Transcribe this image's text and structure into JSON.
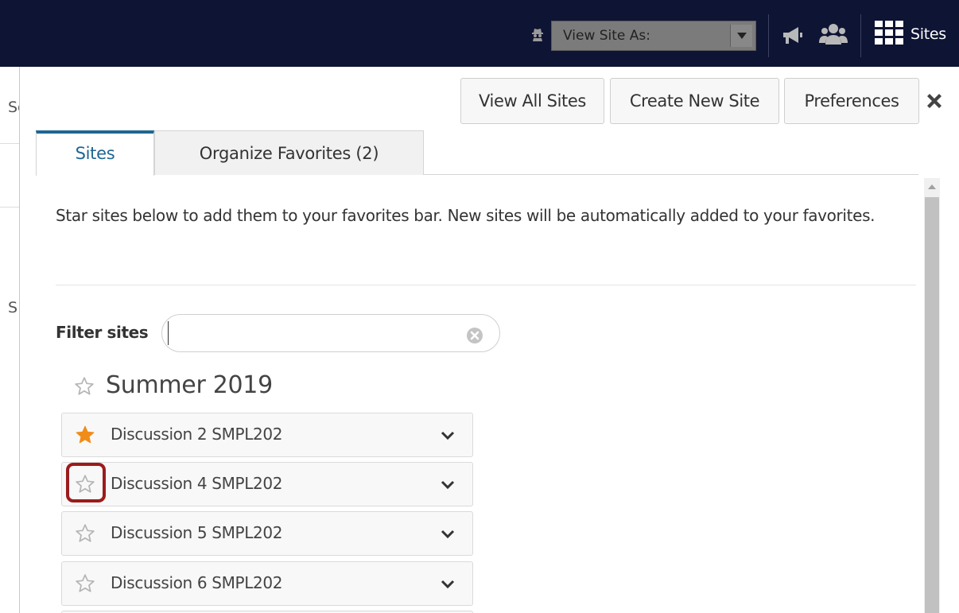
{
  "topbar": {
    "view_site_as_label": "View Site As:",
    "sites_label": "Sites",
    "icons": [
      "user-secret-icon",
      "caret-down-icon",
      "megaphone-icon",
      "people-icon",
      "grid-icon"
    ]
  },
  "background_page": {
    "stub_top": "Sc",
    "stub_mid": "S"
  },
  "panel": {
    "buttons": {
      "view_all": "View All Sites",
      "create_new": "Create New Site",
      "preferences": "Preferences"
    },
    "tabs": [
      {
        "label": "Sites",
        "active": true
      },
      {
        "label": "Organize Favorites (2)",
        "active": false
      }
    ],
    "intro_text": "Star sites below to add them to your favorites bar. New sites will be automatically added to your favorites.",
    "filter": {
      "label": "Filter sites",
      "value": "",
      "placeholder": ""
    },
    "term": {
      "heading": "Summer 2019",
      "favorite": false
    },
    "sites": [
      {
        "name": "Discussion 2 SMPL202",
        "favorite": true
      },
      {
        "name": "Discussion 4 SMPL202",
        "favorite": false,
        "highlighted": true
      },
      {
        "name": "Discussion 5 SMPL202",
        "favorite": false
      },
      {
        "name": "Discussion 6 SMPL202",
        "favorite": false
      }
    ]
  },
  "colors": {
    "topbar_bg": "#0e1433",
    "accent": "#1f6693",
    "star_on": "#f08c1a",
    "star_off": "#b5b5b5",
    "highlight_border": "#9c1b1b"
  }
}
